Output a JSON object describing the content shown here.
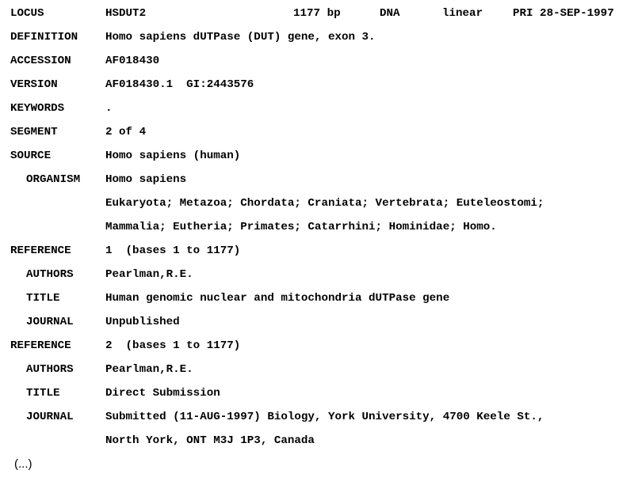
{
  "locus": {
    "key": "LOCUS",
    "name": "HSDUT2",
    "length": "1177 bp",
    "mol_type": "DNA",
    "topology": "linear",
    "division_date": "PRI 28-SEP-1997"
  },
  "definition": {
    "key": "DEFINITION",
    "value": "Homo sapiens dUTPase (DUT) gene, exon 3."
  },
  "accession": {
    "key": "ACCESSION",
    "value": "AF018430"
  },
  "version": {
    "key": "VERSION",
    "value": "AF018430.1  GI:2443576"
  },
  "keywords": {
    "key": "KEYWORDS",
    "value": "."
  },
  "segment": {
    "key": "SEGMENT",
    "value": "2 of 4"
  },
  "source": {
    "key": "SOURCE",
    "value": "Homo sapiens (human)"
  },
  "organism": {
    "key": "ORGANISM",
    "name": "Homo sapiens",
    "lineage": [
      "Eukaryota; Metazoa; Chordata; Craniata; Vertebrata; Euteleostomi;",
      "Mammalia; Eutheria; Primates; Catarrhini; Hominidae; Homo."
    ]
  },
  "references": [
    {
      "key": "REFERENCE",
      "value": "1  (bases 1 to 1177)",
      "authors_key": "AUTHORS",
      "authors": "Pearlman,R.E.",
      "title_key": "TITLE",
      "title": "Human genomic nuclear and mitochondria dUTPase gene",
      "journal_key": "JOURNAL",
      "journal": [
        "Unpublished"
      ]
    },
    {
      "key": "REFERENCE",
      "value": "2  (bases 1 to 1177)",
      "authors_key": "AUTHORS",
      "authors": "Pearlman,R.E.",
      "title_key": "TITLE",
      "title": "Direct Submission",
      "journal_key": "JOURNAL",
      "journal": [
        "Submitted (11-AUG-1997) Biology, York University, 4700 Keele St.,",
        "North York, ONT M3J 1P3, Canada"
      ]
    }
  ],
  "truncation": "(...)"
}
